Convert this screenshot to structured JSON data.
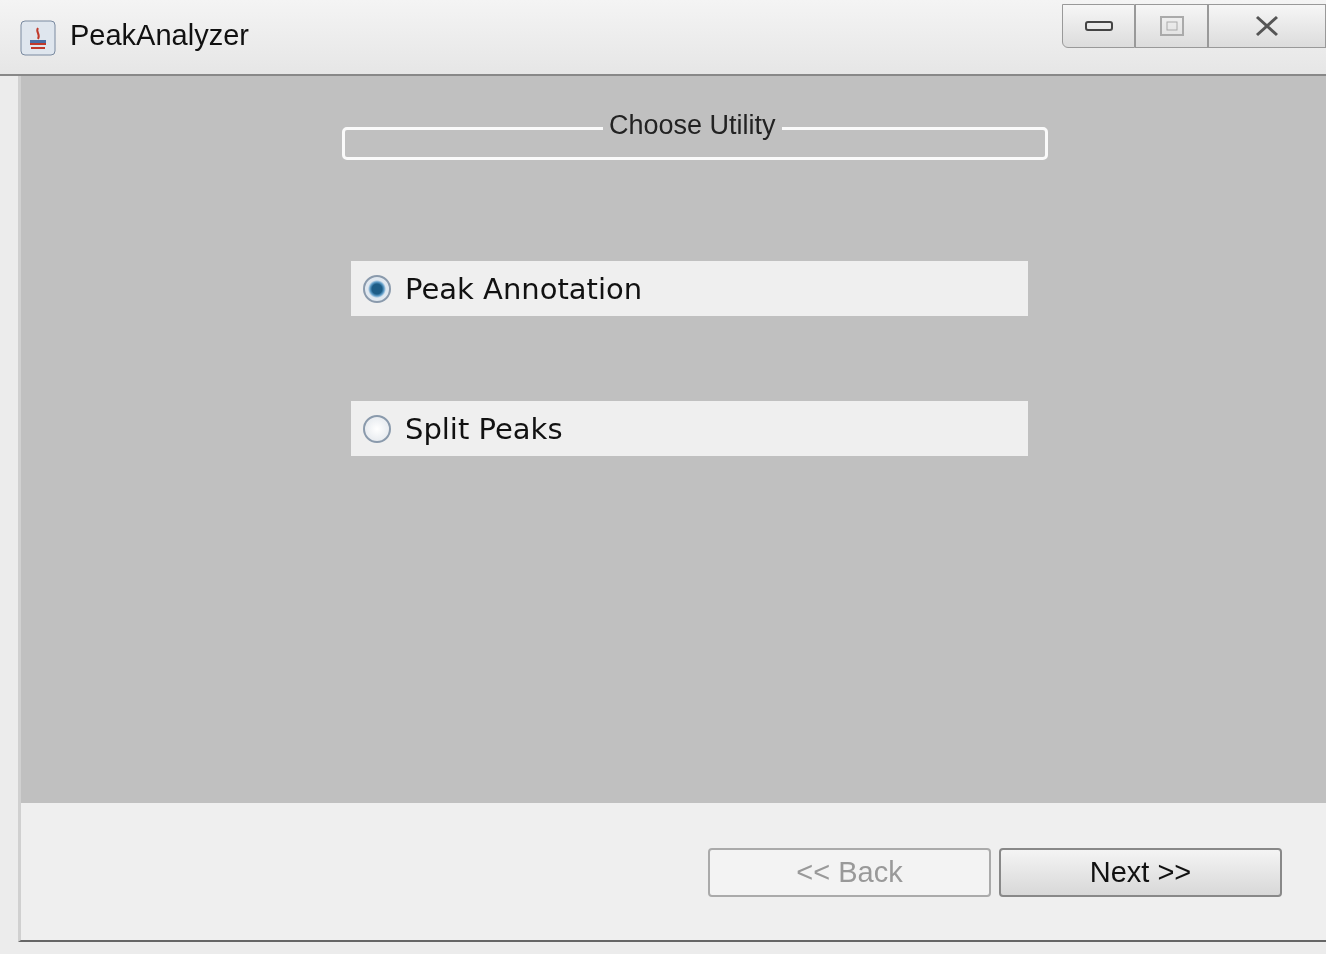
{
  "window": {
    "title": "PeakAnalyzer"
  },
  "group": {
    "title": "Choose Utility"
  },
  "options": [
    {
      "label": "Peak Annotation",
      "selected": true
    },
    {
      "label": "Split Peaks",
      "selected": false
    }
  ],
  "buttons": [
    {
      "label": "<< Back",
      "disabled": true
    },
    {
      "label": "Next >>",
      "disabled": false
    }
  ]
}
